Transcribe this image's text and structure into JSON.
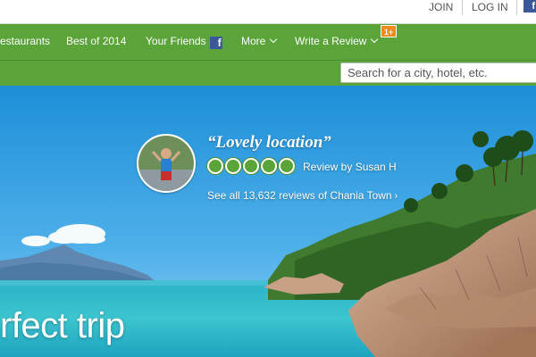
{
  "top_links": {
    "join": "JOIN",
    "login": "LOG IN",
    "facebook": "f"
  },
  "nav": {
    "restaurants": "estaurants",
    "best_of": "Best of 2014",
    "your_friends": "Your Friends",
    "friends_fb": "f",
    "more": "More",
    "write_review": "Write a Review",
    "notification_badge": "1+"
  },
  "search": {
    "placeholder": "Search for a city, hotel, etc."
  },
  "review": {
    "title": "“Lovely location”",
    "rating_bubbles": 5,
    "reviewer": "Review by Susan H",
    "see_all": "See all 13,632 reviews of Chania Town",
    "see_all_arrow": "›"
  },
  "hero": {
    "tagline": "rfect trip"
  },
  "colors": {
    "brand_green": "#5aa43a",
    "notification_orange": "#f08a1c",
    "facebook_blue": "#3b5998"
  },
  "icons": [
    "facebook-icon",
    "chevron-down-icon",
    "rating-bubble-icon",
    "arrow-right-icon"
  ]
}
